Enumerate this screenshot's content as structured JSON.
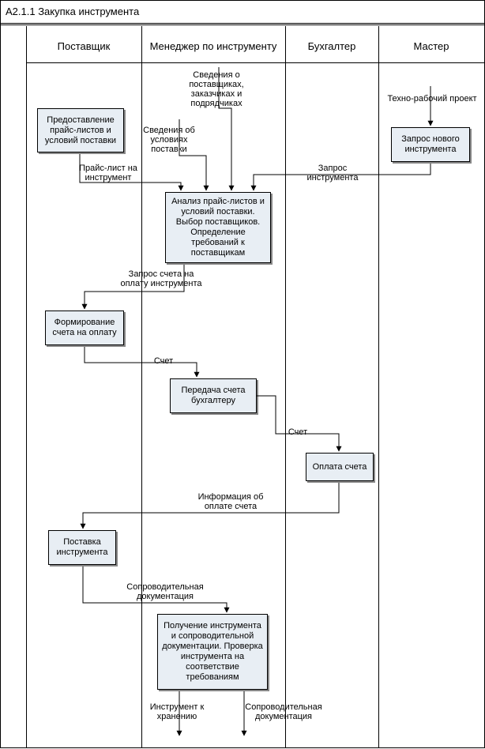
{
  "title": "А2.1.1 Закупка инструмента",
  "lanes": {
    "supplier": "Поставщик",
    "manager": "Менеджер по инструменту",
    "accountant": "Бухгалтер",
    "master": "Мастер"
  },
  "boxes": {
    "provide_pricelists": "Предоставление прайс-листов и условий поставки",
    "request_new": "Запрос нового инструмента",
    "analysis": "Анализ прайс-листов и условий поставки. Выбор поставщиков. Определение требований к поставщикам",
    "invoice_form": "Формирование счета на оплату",
    "invoice_pass": "Передача счета бухгалтеру",
    "payment": "Оплата счета",
    "delivery": "Поставка инструмента",
    "receive": "Получение инструмента и сопроводительной документации. Проверка инструмента на соответствие требованиям"
  },
  "labels": {
    "supplier_info": "Сведения о поставщиках, заказчиках и подрядчиках",
    "delivery_terms": "Сведения об условиях поставки",
    "pricelist": "Прайс-лист на инструмент",
    "tool_request": "Запрос инструмента",
    "tech_project": "Техно-рабочий проект",
    "invoice_req": "Запрос счета на оплату инструмента",
    "invoice1": "Счет",
    "invoice2": "Счет",
    "payment_info": "Информация об оплате счета",
    "docs": "Сопроводительная документация",
    "tool_store": "Инструмент к хранению",
    "docs_out": "Сопроводительная документация"
  }
}
